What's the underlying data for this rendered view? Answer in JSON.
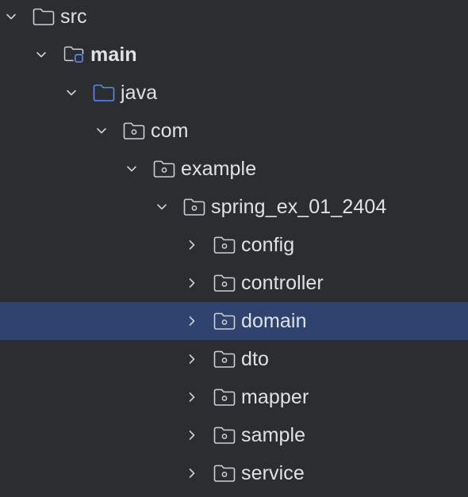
{
  "project_tree": {
    "items": [
      {
        "label": "src",
        "expanded": true,
        "icon": "folder-icon",
        "bold": false,
        "selected": false
      },
      {
        "label": "main",
        "expanded": true,
        "icon": "source-root-folder-icon",
        "bold": true,
        "selected": false
      },
      {
        "label": "java",
        "expanded": true,
        "icon": "java-source-folder-icon",
        "bold": false,
        "selected": false
      },
      {
        "label": "com",
        "expanded": true,
        "icon": "package-icon",
        "bold": false,
        "selected": false
      },
      {
        "label": "example",
        "expanded": true,
        "icon": "package-icon",
        "bold": false,
        "selected": false
      },
      {
        "label": "spring_ex_01_2404",
        "expanded": true,
        "icon": "package-icon",
        "bold": false,
        "selected": false
      },
      {
        "label": "config",
        "expanded": false,
        "icon": "package-icon",
        "bold": false,
        "selected": false
      },
      {
        "label": "controller",
        "expanded": false,
        "icon": "package-icon",
        "bold": false,
        "selected": false
      },
      {
        "label": "domain",
        "expanded": false,
        "icon": "package-icon",
        "bold": false,
        "selected": true
      },
      {
        "label": "dto",
        "expanded": false,
        "icon": "package-icon",
        "bold": false,
        "selected": false
      },
      {
        "label": "mapper",
        "expanded": false,
        "icon": "package-icon",
        "bold": false,
        "selected": false
      },
      {
        "label": "sample",
        "expanded": false,
        "icon": "package-icon",
        "bold": false,
        "selected": false
      },
      {
        "label": "service",
        "expanded": false,
        "icon": "package-icon",
        "bold": false,
        "selected": false
      }
    ]
  },
  "colors": {
    "background": "#2b2d30",
    "selection": "#2e436e",
    "text": "#dfe1e5",
    "icon_gray": "#ced0d6",
    "icon_blue": "#548af7"
  }
}
